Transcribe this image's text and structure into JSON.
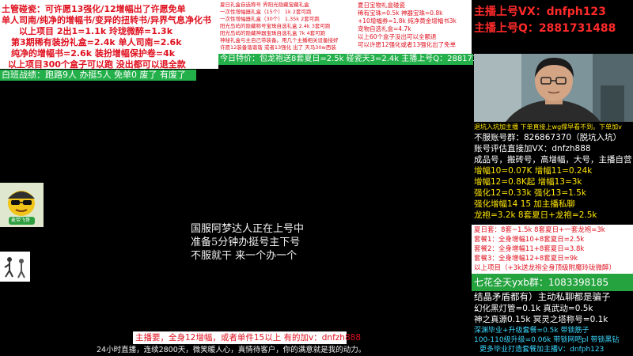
{
  "top_left_panel": {
    "lines": [
      "土管碰瓷：可许愿13强化/12增幅出了许愿免单",
      "单人司南/纯净的增幅书/变异的扭转书/异界气息净化书",
      "以上项目 2出1=1.1k   玲珑微醉=1.3k",
      "第3期稀有装扮礼盒=2.4k  单人司南=2.6k",
      "纯净的增幅书=2.6k    装扮增幅保护卷=4k",
      "以上项目300个盒子可以跑  没出都可以退全款"
    ]
  },
  "top_mid_panel_1": {
    "lines": [
      "夏日礼盒自选称号  界阳光隐藏宝藏礼盒",
      "一次性增幅器礼盒（15个） 1k       2套可跑",
      "一次性增幅器礼盒（30个） 1.35k    2套可跑",
      "阳光岛屿的隐藏称号宝珠自选礼盒  2.4k 3套可跑",
      "阳光岛屿的隐藏神器宝珠自选礼盒 7k    4套可跑",
      "神秘礼盒与主自己带装备。用几个主播相关设备接好",
      "许愿12装备谐谐谐 或者13强化 出了 天马30w西装"
    ]
  },
  "top_mid_panel_2": {
    "lines": [
      "夏日宝物礼盒碰瓷",
      "稀有宝珠=0.5k    神器宝珠=0.8k",
      "+10增幅券=1.8k  纯净黄金增幅书3k",
      "宠物自选礼盒=4.7k",
      "以上60个盒子没出可以全额退",
      "可以许愿12强化或者13强化出了免单"
    ]
  },
  "special_price_strip": "今日特价：包龙袍送8套夏日=2.5k  碰瓷天3=2.4k 主播上号Q：2881731488",
  "squad_strip": "白班战绩：跑路9人  办挺5人  免单0   废了 有废了",
  "right_top": {
    "vx": "主播上号VX：dnfph123",
    "qq": "主播上号Q：2881731488"
  },
  "right_mid": {
    "banner": "退坑入坑加主播  下单直接上wg撑早看不到。下单加v",
    "lines_white": [
      "不服账号群：826867370（脱坑入坑）",
      "账号评估直接加VX：dnfzh888",
      "成品号，搬砖号，高增幅，大号，主播自营"
    ],
    "lines_yellow": [
      "增幅10=0.07K  增幅11=0.24k",
      "增幅12=0.8K起  增幅13=3k",
      "强化12=0.33k    强化13=1.5k",
      "强化增幅14  15   加主播私聊",
      "龙袍=3.2k    8套夏日+龙袍=2.5k"
    ]
  },
  "right_red": {
    "lines": [
      "夏日套：8套~1.5k 8套夏日+一套龙袍=3k",
      "套餐1：全身增幅10+8套夏日=2.5k",
      "套餐2：全身增幅11+8套夏日=3.8k",
      "套餐3：全身增幅12+8套夏日=9k",
      "以上项目（+3k送龙袍全身顶级附魔玲珑微醉）"
    ]
  },
  "right_green": "七花全天yxb群：1083398185",
  "right_bottom": {
    "line1": "结晶矛盾都有）主动私聊都是骗子",
    "line2": "幻化黑灯管=0.1k 真武动=0.5k",
    "line3": "神之真源0.15k  冥灵之塔称号=0.1k",
    "cyan": [
      "深渊毕业+升级套餐=0.5k 带锁筋子",
      "100-110级升级=0.06k 带锁网吧pl  带锁黑钻",
      "更多毕业打造套餐加主播V：dnfph123"
    ]
  },
  "center_text": [
    "国服阿梦达人正在上号中",
    "准备5分钟办挺号主下号",
    "不服就干 来一个办一个"
  ],
  "bottom_banner_1": "主播要，全身12增幅，或者单件15以上 有的加v：dnfzh888",
  "bottom_banner_2": "24小时直播，连续2800天，微笑暖人心，真情待客户，你的满意就是我的动力。",
  "mascot_badge": "麦带飞哥"
}
